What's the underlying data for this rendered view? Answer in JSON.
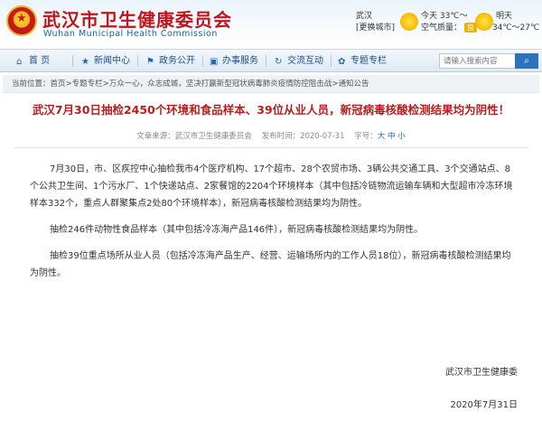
{
  "header": {
    "org_name_cn": "武汉市卫生健康委员会",
    "org_name_en": "Wuhan Municipal Health Commission",
    "city": "武汉",
    "city_switch": "[更换城市]",
    "today_label": "今天",
    "today_temp": "33℃～",
    "aqi_label": "空气质量：",
    "aqi_value": "良",
    "tomorrow_label": "明天",
    "tomorrow_temp": "34℃～27℃"
  },
  "nav": {
    "items": [
      {
        "label": "首    页",
        "icon": "home-icon"
      },
      {
        "label": "新闻中心",
        "icon": "news-icon"
      },
      {
        "label": "政务公开",
        "icon": "open-gov-icon"
      },
      {
        "label": "办事服务",
        "icon": "service-icon"
      },
      {
        "label": "交流互动",
        "icon": "interaction-icon"
      },
      {
        "label": "专题专栏",
        "icon": "topic-icon"
      }
    ],
    "search_placeholder": "请输入搜索内容"
  },
  "breadcrumb": {
    "prefix": "当前位置：",
    "items": [
      "首页",
      "专题专栏",
      "万众一心，众志成城，坚决打赢新型冠状病毒肺炎疫情防控阻击战",
      "通知公告"
    ],
    "sep": ">"
  },
  "article": {
    "title": "武汉7月30日抽检2450个环境和食品样本、39位从业人员，新冠病毒核酸检测结果均为阴性！",
    "source_label": "文章来源：",
    "source": "武汉市卫生健康委员会",
    "date_label": "发布时间：",
    "date": "2020-07-31",
    "font_size_label": "字号：",
    "size_large": "大",
    "size_medium": "中",
    "size_small": "小",
    "paragraphs": [
      "7月30日，市、区疾控中心抽检我市4个医疗机构、17个超市、28个农贸市场、3辆公共交通工具、3个交通站点、8个公共卫生间、1个污水厂、1个快递站点、2家餐馆的2204个环境样本（其中包括冷链物流运输车辆和大型超市冷冻环境样本332个，重点人群聚集点2处80个环境样本），新冠病毒核酸检测结果均为阴性。",
      "抽检246件动物性食品样本（其中包括冷冻海产品146件），新冠病毒核酸检测结果均为阴性。",
      "抽检39位重点场所从业人员（包括冷冻海产品生产、经营、运输场所内的工作人员18位），新冠病毒核酸检测结果均为阴性。"
    ],
    "signature": "武汉市卫生健康委",
    "sign_date": "2020年7月31日"
  },
  "colors": {
    "brand_red": "#c0151a",
    "nav_blue": "#1b4f8c",
    "title_red": "#b61f1f"
  }
}
